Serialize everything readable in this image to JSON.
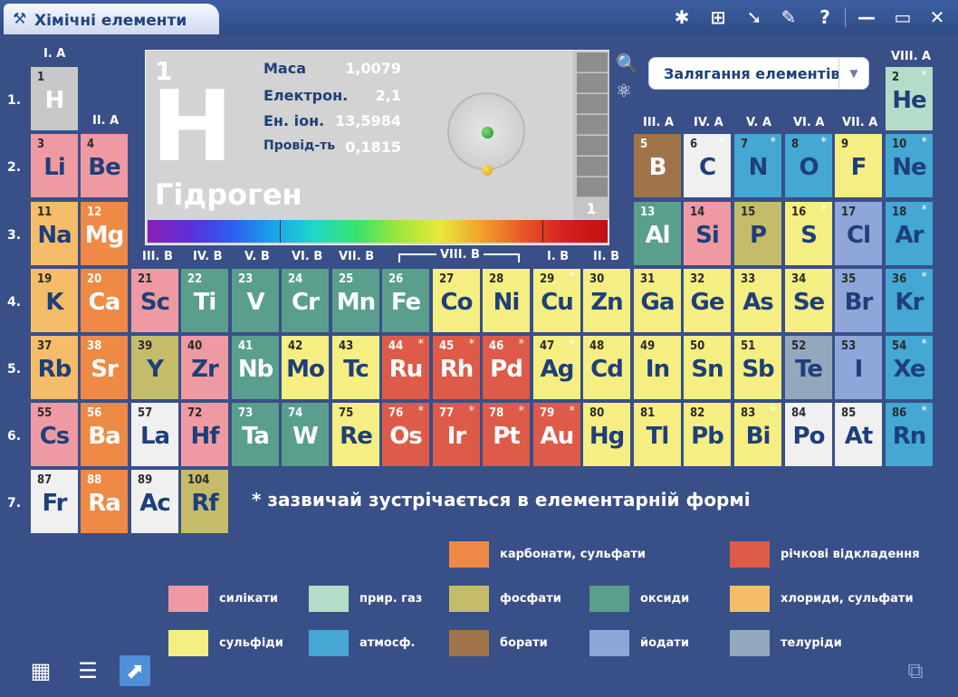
{
  "window": {
    "title": "Хімічні елементи",
    "title_icon": "wrench-icon",
    "buttons": [
      "molecules-icon",
      "calculator-icon",
      "pointer-icon",
      "pencil-icon",
      "help-icon",
      "minimize-icon",
      "maximize-icon",
      "close-icon"
    ],
    "button_glyphs": [
      "✱",
      "⊞",
      "➘",
      "✎",
      "?",
      "—",
      "▭",
      "✕"
    ]
  },
  "info": {
    "number": "1",
    "symbol": "H",
    "name": "Гідроген",
    "props": [
      {
        "label": "Маса",
        "value": "1,0079"
      },
      {
        "label": "Електрон.",
        "value": "2,1"
      },
      {
        "label": "Ен. іон.",
        "value": "13,5984"
      },
      {
        "label": "Провід-ть",
        "value": "0,1815"
      }
    ],
    "shell_count": "1"
  },
  "dropdown": {
    "value": "Залягання елементів",
    "arrow": "▼"
  },
  "icons": {
    "zoom": "🔍",
    "atom": "⚛"
  },
  "group_labels": {
    "IA": "I. A",
    "IIA": "II. A",
    "IIIA": "III. A",
    "IVA": "IV. A",
    "VA": "V. A",
    "VIA": "VI. A",
    "VIIA": "VII. A",
    "VIIIA": "VIII. A",
    "IIIB": "III. B",
    "IVB": "IV. B",
    "VB": "V. B",
    "VIB": "VI. B",
    "VIIB": "VII. B",
    "VIIIB": "VIII. B",
    "IB": "I. B",
    "IIB": "II. B"
  },
  "period_labels": [
    "1.",
    "2.",
    "3.",
    "4.",
    "5.",
    "6.",
    "7."
  ],
  "colors": {
    "silicates": "#ef9aa3",
    "noble_gas": "#b4dcc8",
    "carbonates": "#ee8a45",
    "phosphates": "#c4bc6a",
    "oxides": "#5a9e8e",
    "river": "#dd5b48",
    "chlorides": "#f5bc6a",
    "sulfides": "#f5ee82",
    "atmos": "#44a7d4",
    "borates": "#a0744a",
    "iodates": "#8ea6d8",
    "tellurides": "#93a8bc",
    "none": "#f0f0f0",
    "hydrogen": "#c8c8c8"
  },
  "elements": [
    {
      "n": "1",
      "s": "H",
      "c": "hydrogen",
      "star": false
    },
    {
      "n": "2",
      "s": "He",
      "c": "noble_gas",
      "star": true
    },
    {
      "n": "3",
      "s": "Li",
      "c": "silicates",
      "star": false
    },
    {
      "n": "4",
      "s": "Be",
      "c": "silicates",
      "star": false
    },
    {
      "n": "5",
      "s": "B",
      "c": "borates",
      "star": false
    },
    {
      "n": "6",
      "s": "C",
      "c": "none",
      "star": true
    },
    {
      "n": "7",
      "s": "N",
      "c": "atmos",
      "star": true
    },
    {
      "n": "8",
      "s": "O",
      "c": "atmos",
      "star": true
    },
    {
      "n": "9",
      "s": "F",
      "c": "sulfides",
      "star": false
    },
    {
      "n": "10",
      "s": "Ne",
      "c": "atmos",
      "star": true
    },
    {
      "n": "11",
      "s": "Na",
      "c": "chlorides",
      "star": false
    },
    {
      "n": "12",
      "s": "Mg",
      "c": "carbonates",
      "star": false
    },
    {
      "n": "13",
      "s": "Al",
      "c": "oxides",
      "star": false
    },
    {
      "n": "14",
      "s": "Si",
      "c": "silicates",
      "star": false
    },
    {
      "n": "15",
      "s": "P",
      "c": "phosphates",
      "star": false
    },
    {
      "n": "16",
      "s": "S",
      "c": "sulfides",
      "star": true
    },
    {
      "n": "17",
      "s": "Cl",
      "c": "iodates",
      "star": false
    },
    {
      "n": "18",
      "s": "Ar",
      "c": "atmos",
      "star": true
    },
    {
      "n": "19",
      "s": "K",
      "c": "chlorides",
      "star": false
    },
    {
      "n": "20",
      "s": "Ca",
      "c": "carbonates",
      "star": false
    },
    {
      "n": "21",
      "s": "Sc",
      "c": "silicates",
      "star": false
    },
    {
      "n": "22",
      "s": "Ti",
      "c": "oxides",
      "star": false
    },
    {
      "n": "23",
      "s": "V",
      "c": "oxides",
      "star": false
    },
    {
      "n": "24",
      "s": "Cr",
      "c": "oxides",
      "star": false
    },
    {
      "n": "25",
      "s": "Mn",
      "c": "oxides",
      "star": false
    },
    {
      "n": "26",
      "s": "Fe",
      "c": "oxides",
      "star": false
    },
    {
      "n": "27",
      "s": "Co",
      "c": "sulfides",
      "star": false
    },
    {
      "n": "28",
      "s": "Ni",
      "c": "sulfides",
      "star": false
    },
    {
      "n": "29",
      "s": "Cu",
      "c": "sulfides",
      "star": true
    },
    {
      "n": "30",
      "s": "Zn",
      "c": "sulfides",
      "star": false
    },
    {
      "n": "31",
      "s": "Ga",
      "c": "sulfides",
      "star": false
    },
    {
      "n": "32",
      "s": "Ge",
      "c": "sulfides",
      "star": false
    },
    {
      "n": "33",
      "s": "As",
      "c": "sulfides",
      "star": false
    },
    {
      "n": "34",
      "s": "Se",
      "c": "sulfides",
      "star": false
    },
    {
      "n": "35",
      "s": "Br",
      "c": "iodates",
      "star": false
    },
    {
      "n": "36",
      "s": "Kr",
      "c": "atmos",
      "star": true
    },
    {
      "n": "37",
      "s": "Rb",
      "c": "chlorides",
      "star": false
    },
    {
      "n": "38",
      "s": "Sr",
      "c": "carbonates",
      "star": false
    },
    {
      "n": "39",
      "s": "Y",
      "c": "phosphates",
      "star": false
    },
    {
      "n": "40",
      "s": "Zr",
      "c": "silicates",
      "star": false
    },
    {
      "n": "41",
      "s": "Nb",
      "c": "oxides",
      "star": false
    },
    {
      "n": "42",
      "s": "Mo",
      "c": "sulfides",
      "star": false
    },
    {
      "n": "43",
      "s": "Tc",
      "c": "sulfides",
      "star": false
    },
    {
      "n": "44",
      "s": "Ru",
      "c": "river",
      "star": true
    },
    {
      "n": "45",
      "s": "Rh",
      "c": "river",
      "star": true
    },
    {
      "n": "46",
      "s": "Pd",
      "c": "river",
      "star": true
    },
    {
      "n": "47",
      "s": "Ag",
      "c": "sulfides",
      "star": true
    },
    {
      "n": "48",
      "s": "Cd",
      "c": "sulfides",
      "star": false
    },
    {
      "n": "49",
      "s": "In",
      "c": "sulfides",
      "star": false
    },
    {
      "n": "50",
      "s": "Sn",
      "c": "sulfides",
      "star": false
    },
    {
      "n": "51",
      "s": "Sb",
      "c": "sulfides",
      "star": false
    },
    {
      "n": "52",
      "s": "Te",
      "c": "tellurides",
      "star": false
    },
    {
      "n": "53",
      "s": "I",
      "c": "iodates",
      "star": false
    },
    {
      "n": "54",
      "s": "Xe",
      "c": "atmos",
      "star": true
    },
    {
      "n": "55",
      "s": "Cs",
      "c": "silicates",
      "star": false
    },
    {
      "n": "56",
      "s": "Ba",
      "c": "carbonates",
      "star": false
    },
    {
      "n": "57",
      "s": "La",
      "c": "none",
      "star": false
    },
    {
      "n": "72",
      "s": "Hf",
      "c": "silicates",
      "star": false
    },
    {
      "n": "73",
      "s": "Ta",
      "c": "oxides",
      "star": false
    },
    {
      "n": "74",
      "s": "W",
      "c": "oxides",
      "star": false
    },
    {
      "n": "75",
      "s": "Re",
      "c": "sulfides",
      "star": false
    },
    {
      "n": "76",
      "s": "Os",
      "c": "river",
      "star": true
    },
    {
      "n": "77",
      "s": "Ir",
      "c": "river",
      "star": true
    },
    {
      "n": "78",
      "s": "Pt",
      "c": "river",
      "star": true
    },
    {
      "n": "79",
      "s": "Au",
      "c": "river",
      "star": true
    },
    {
      "n": "80",
      "s": "Hg",
      "c": "sulfides",
      "star": false
    },
    {
      "n": "81",
      "s": "Tl",
      "c": "sulfides",
      "star": false
    },
    {
      "n": "82",
      "s": "Pb",
      "c": "sulfides",
      "star": false
    },
    {
      "n": "83",
      "s": "Bi",
      "c": "sulfides",
      "star": true
    },
    {
      "n": "84",
      "s": "Po",
      "c": "none",
      "star": false
    },
    {
      "n": "85",
      "s": "At",
      "c": "none",
      "star": false
    },
    {
      "n": "86",
      "s": "Rn",
      "c": "atmos",
      "star": true
    },
    {
      "n": "87",
      "s": "Fr",
      "c": "none",
      "star": false
    },
    {
      "n": "88",
      "s": "Ra",
      "c": "carbonates",
      "star": false
    },
    {
      "n": "89",
      "s": "Ac",
      "c": "none",
      "star": false
    },
    {
      "n": "104",
      "s": "Rf",
      "c": "phosphates",
      "star": false
    }
  ],
  "note": "* зазвичай зустрічається в елементарній формі",
  "legend": [
    {
      "key": "carbonates",
      "label": "карбонати, сульфати"
    },
    {
      "key": "river",
      "label": "річкові відкладення"
    },
    {
      "key": "silicates",
      "label": "силікати"
    },
    {
      "key": "noble_gas",
      "label": "прир. газ"
    },
    {
      "key": "phosphates",
      "label": "фосфати"
    },
    {
      "key": "oxides",
      "label": "оксиди"
    },
    {
      "key": "chlorides",
      "label": "хлориди, сульфати"
    },
    {
      "key": "sulfides",
      "label": "сульфіди"
    },
    {
      "key": "atmos",
      "label": "атмосф."
    },
    {
      "key": "borates",
      "label": "борати"
    },
    {
      "key": "iodates",
      "label": "йодати"
    },
    {
      "key": "tellurides",
      "label": "телуріди"
    }
  ],
  "bottom_icons": {
    "grid": "▦",
    "list": "☰",
    "chart": "⬈",
    "export": "⧉"
  }
}
